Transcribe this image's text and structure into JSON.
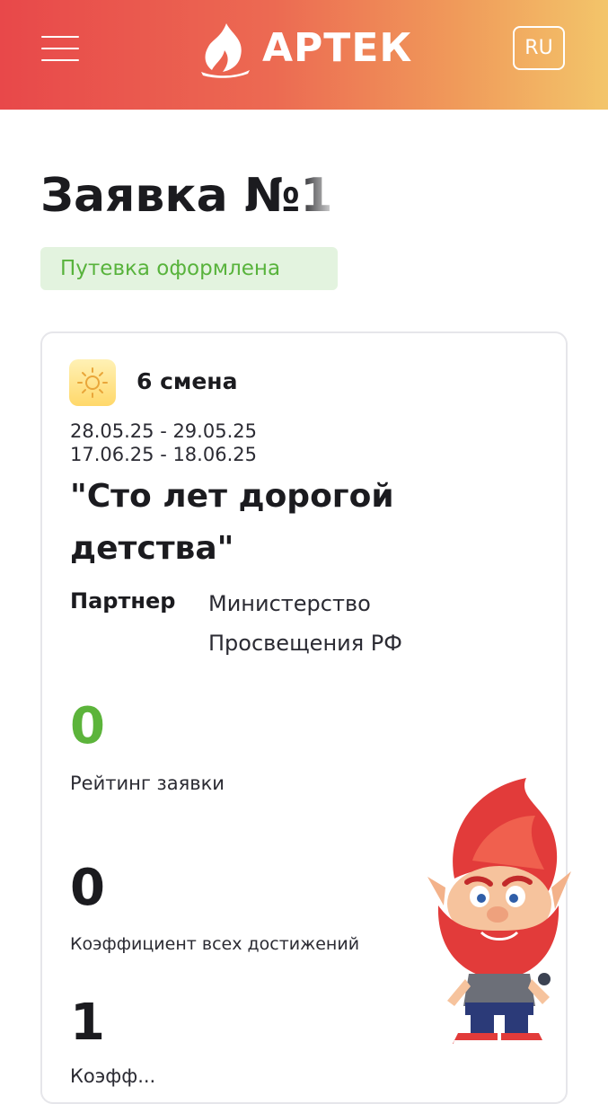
{
  "header": {
    "brand": "АРТЕК",
    "language": "RU",
    "menu_icon": "hamburger-icon",
    "logo_icon": "flame-logo-icon"
  },
  "application": {
    "title": "Заявка №1",
    "status": "Путевка оформлена"
  },
  "card": {
    "shift_icon": "sun-icon",
    "shift": "6 смена",
    "dates": [
      "28.05.25 - 29.05.25",
      "17.06.25 - 18.06.25"
    ],
    "program": "\"Сто лет дорогой детства\"",
    "partner_label": "Партнер",
    "partner_value": "Министерство Просвещения РФ",
    "stats": [
      {
        "value": "0",
        "label": "Рейтинг заявки"
      },
      {
        "value": "0",
        "label": "Коэффициент всех достижений"
      },
      {
        "value": "1",
        "label": "Коэфф..."
      }
    ]
  },
  "colors": {
    "header_gradient_start": "#e8484a",
    "header_gradient_end": "#f3c56a",
    "status_green": "#58b33c",
    "status_bg": "#e3f3df",
    "rating_green": "#5cb43b"
  }
}
